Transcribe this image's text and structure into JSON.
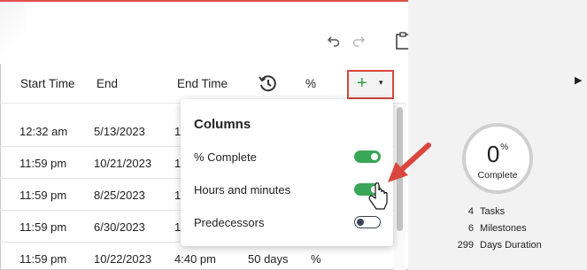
{
  "window": {
    "maximize_icon": "square-icon",
    "close_icon": "close-icon",
    "close_glyph": "✕"
  },
  "toolbar": {
    "undo_icon": "undo-icon",
    "redo_icon": "redo-icon",
    "clipboard_icon": "clipboard-icon"
  },
  "grid": {
    "columns": [
      "Start Time",
      "End",
      "End Time",
      "",
      "%"
    ],
    "history_icon": "history-icon",
    "add_column": {
      "plus": "+",
      "caret": "▾"
    },
    "rows": [
      {
        "start_time": "12:32 am",
        "end": "5/13/2023",
        "end_time": "1",
        "duration": "",
        "pct": ""
      },
      {
        "start_time": "11:59 pm",
        "end": "10/21/2023",
        "end_time": "1",
        "duration": "",
        "pct": ""
      },
      {
        "start_time": "11:59 pm",
        "end": "8/25/2023",
        "end_time": "1",
        "duration": "",
        "pct": ""
      },
      {
        "start_time": "11:59 pm",
        "end": "6/30/2023",
        "end_time": "1",
        "duration": "",
        "pct": ""
      },
      {
        "start_time": "11:59 pm",
        "end": "10/22/2023",
        "end_time": "4:40 pm",
        "duration": "50 days",
        "pct": "%"
      }
    ]
  },
  "columns_menu": {
    "title": "Columns",
    "options": [
      {
        "label": "% Complete",
        "on": true
      },
      {
        "label": "Hours and minutes",
        "on": true
      },
      {
        "label": "Predecessors",
        "on": false
      }
    ]
  },
  "summary": {
    "percent": "0",
    "percent_sign": "%",
    "percent_label": "Complete",
    "stats": [
      {
        "value": "4",
        "label": "Tasks"
      },
      {
        "value": "6",
        "label": "Milestones"
      },
      {
        "value": "299",
        "label": "Days Duration"
      }
    ]
  },
  "colors": {
    "accent_red": "#d9463d",
    "toggle_green": "#3aa657",
    "plus_green": "#2e9e48"
  }
}
